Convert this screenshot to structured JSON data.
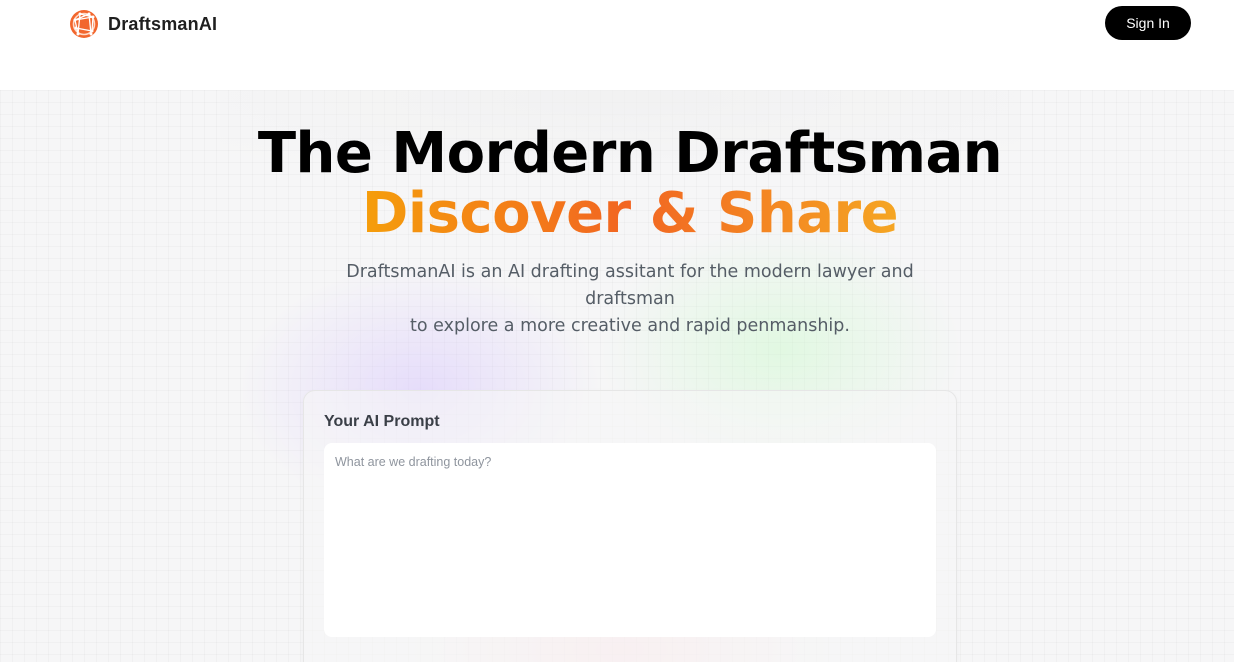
{
  "header": {
    "brand": "DraftsmanAI",
    "logo_icon": "globe-logo-icon",
    "signin_label": "Sign In"
  },
  "hero": {
    "title_line1": "The Mordern Draftsman",
    "title_line2": "Discover & Share",
    "subtitle_line1": "DraftsmanAI is an AI drafting assitant for the modern lawyer and draftsman",
    "subtitle_line2": "to explore a more creative and rapid penmanship."
  },
  "prompt": {
    "label": "Your AI Prompt",
    "placeholder": "What are we drafting today?",
    "value": ""
  },
  "colors": {
    "accent_gradient_start": "#f59e0b",
    "accent_gradient_mid": "#f26522",
    "logo_orange": "#f2662d",
    "button_bg": "#000000"
  }
}
